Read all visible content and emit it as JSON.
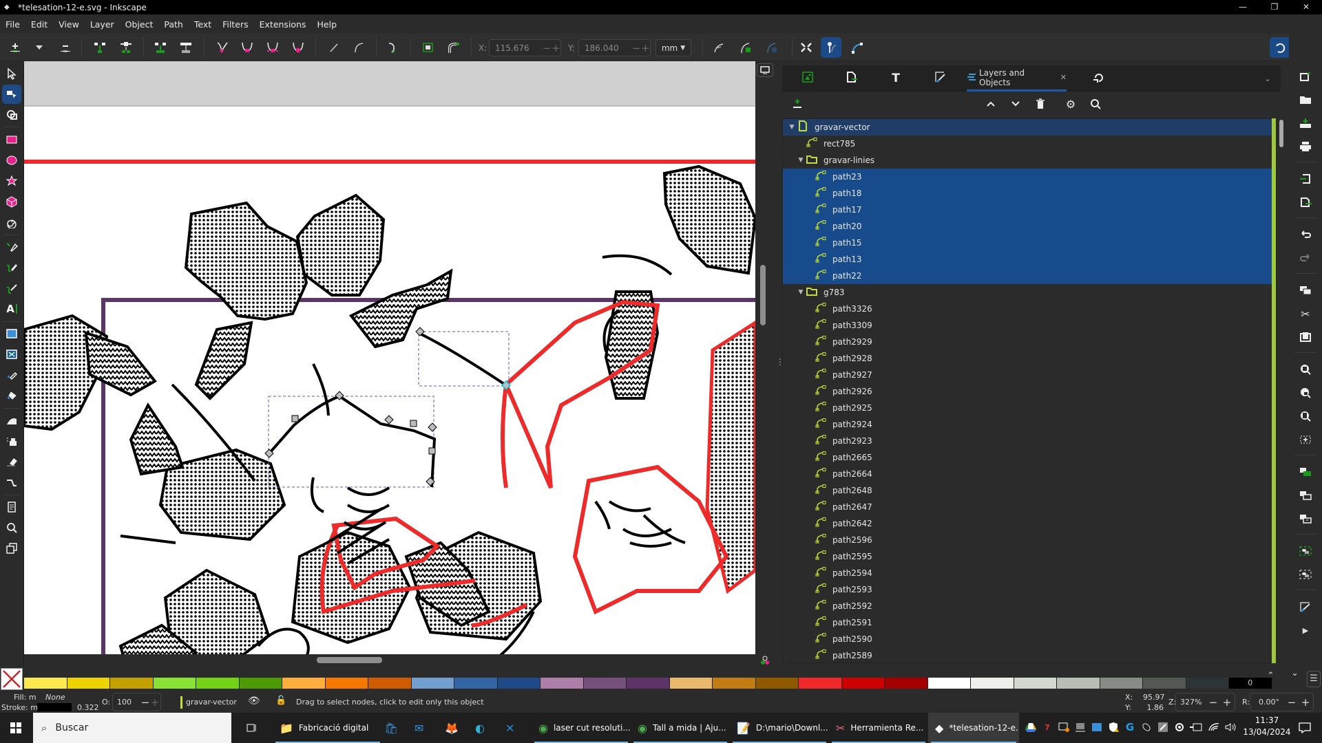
{
  "window": {
    "title": "*telesation-12-e.svg - Inkscape",
    "controls": [
      "minimize",
      "maximize",
      "close"
    ]
  },
  "menu": [
    "File",
    "Edit",
    "View",
    "Layer",
    "Object",
    "Path",
    "Text",
    "Filters",
    "Extensions",
    "Help"
  ],
  "tool_controls": {
    "node_buttons": [
      "insert-node-icon",
      "insert-node-menu-icon",
      "delete-node-icon",
      "join-nodes-icon",
      "break-path-icon",
      "join-segment-icon",
      "delete-segment-icon",
      "cusp-node-icon",
      "smooth-node-icon",
      "symmetric-node-icon",
      "auto-smooth-node-icon",
      "straight-segment-icon",
      "curve-segment-icon",
      "object-to-path-icon",
      "bounding-box-icon",
      "stroke-to-path-icon"
    ],
    "x_label": "X:",
    "x_value": "115.676",
    "y_label": "Y:",
    "y_value": "186.040",
    "unit": "mm",
    "right_buttons": [
      "show-path-effects-icon",
      "show-clipping-icon",
      "show-mask-icon",
      "show-transform-handles-icon",
      "show-handles-icon",
      "show-outline-icon"
    ]
  },
  "toolbox": [
    "selector",
    "node",
    "shape-builder",
    "rectangle",
    "ellipse",
    "star",
    "3d-box",
    "spiral",
    "pen",
    "pencil",
    "calligraphy",
    "text",
    "gradient",
    "mesh",
    "dropper",
    "paint-bucket",
    "tweak",
    "spray",
    "eraser",
    "connector",
    "pages",
    "zoom",
    "measure"
  ],
  "dialog": {
    "tabs": [
      {
        "icon": "document-properties-icon",
        "label": ""
      },
      {
        "icon": "export-icon",
        "label": ""
      },
      {
        "icon": "text-font-icon",
        "label": ""
      },
      {
        "icon": "fill-stroke-icon",
        "label": ""
      },
      {
        "icon": "layers-icon",
        "label": "Layers and Objects",
        "active": true
      },
      {
        "icon": "transform-icon",
        "label": ""
      }
    ],
    "layer_tools": [
      "add-layer",
      "move-up",
      "move-down",
      "delete",
      "settings",
      "search"
    ],
    "tree": [
      {
        "name": "gravar-vector",
        "type": "layer",
        "depth": 0,
        "expanded": true,
        "state": "layer-selected"
      },
      {
        "name": "rect785",
        "type": "path",
        "depth": 1
      },
      {
        "name": "gravar-linies",
        "type": "group",
        "depth": 1,
        "expanded": true
      },
      {
        "name": "path23",
        "type": "path",
        "depth": 2,
        "state": "selected"
      },
      {
        "name": "path18",
        "type": "path",
        "depth": 2,
        "state": "selected"
      },
      {
        "name": "path17",
        "type": "path",
        "depth": 2,
        "state": "selected"
      },
      {
        "name": "path20",
        "type": "path",
        "depth": 2,
        "state": "selected"
      },
      {
        "name": "path15",
        "type": "path",
        "depth": 2,
        "state": "selected"
      },
      {
        "name": "path13",
        "type": "path",
        "depth": 2,
        "state": "selected"
      },
      {
        "name": "path22",
        "type": "path",
        "depth": 2,
        "state": "selected"
      },
      {
        "name": "g783",
        "type": "group",
        "depth": 1,
        "expanded": true
      },
      {
        "name": "path3326",
        "type": "path",
        "depth": 2
      },
      {
        "name": "path3309",
        "type": "path",
        "depth": 2
      },
      {
        "name": "path2929",
        "type": "path",
        "depth": 2
      },
      {
        "name": "path2928",
        "type": "path",
        "depth": 2
      },
      {
        "name": "path2927",
        "type": "path",
        "depth": 2
      },
      {
        "name": "path2926",
        "type": "path",
        "depth": 2
      },
      {
        "name": "path2925",
        "type": "path",
        "depth": 2
      },
      {
        "name": "path2924",
        "type": "path",
        "depth": 2
      },
      {
        "name": "path2923",
        "type": "path",
        "depth": 2
      },
      {
        "name": "path2665",
        "type": "path",
        "depth": 2
      },
      {
        "name": "path2664",
        "type": "path",
        "depth": 2
      },
      {
        "name": "path2648",
        "type": "path",
        "depth": 2
      },
      {
        "name": "path2647",
        "type": "path",
        "depth": 2
      },
      {
        "name": "path2642",
        "type": "path",
        "depth": 2
      },
      {
        "name": "path2596",
        "type": "path",
        "depth": 2
      },
      {
        "name": "path2595",
        "type": "path",
        "depth": 2
      },
      {
        "name": "path2594",
        "type": "path",
        "depth": 2
      },
      {
        "name": "path2593",
        "type": "path",
        "depth": 2
      },
      {
        "name": "path2592",
        "type": "path",
        "depth": 2
      },
      {
        "name": "path2591",
        "type": "path",
        "depth": 2
      },
      {
        "name": "path2590",
        "type": "path",
        "depth": 2
      },
      {
        "name": "path2589",
        "type": "path",
        "depth": 2
      }
    ]
  },
  "commands": [
    "new-document",
    "open",
    "save",
    "print",
    "import",
    "export",
    "undo",
    "redo",
    "copy",
    "cut",
    "paste",
    "zoom-selection",
    "zoom-drawing",
    "zoom-page",
    "zoom-center-page",
    "duplicate",
    "clone",
    "unlink-clone",
    "group",
    "ungroup",
    "fill-stroke",
    "more"
  ],
  "palette": {
    "colors": [
      "#fce94f",
      "#edd400",
      "#c4a000",
      "#8ae234",
      "#73d216",
      "#4e9a06",
      "#fcaf3e",
      "#f57900",
      "#ce5c00",
      "#729fcf",
      "#3465a4",
      "#204a87",
      "#ad7fa8",
      "#75507b",
      "#5c3566",
      "#e9b96e",
      "#c17d11",
      "#8f5902",
      "#ef2929",
      "#cc0000",
      "#a40000",
      "#ffffff",
      "#eeeeec",
      "#d3d7cf",
      "#babdb6",
      "#888a85",
      "#555753",
      "#2e3436",
      "#000000"
    ],
    "last_swatch_label": "0"
  },
  "status": {
    "fill_label": "Fill:",
    "fill_m": "m",
    "fill_value": "None",
    "stroke_label": "Stroke:",
    "stroke_m": "m",
    "stroke_color": "#000000",
    "stroke_width": "0.322",
    "opacity_label": "O:",
    "opacity_value": "100",
    "layer": "gravar-vector",
    "message": "Drag to select nodes, click to edit only this object",
    "cursor_x_label": "X:",
    "cursor_x": "95.97",
    "cursor_y_label": "Y:",
    "cursor_y": "1.86",
    "zoom_label": "Z:",
    "zoom": "327%",
    "rotation_label": "R:",
    "rotation": "0.00°"
  },
  "taskbar": {
    "search_placeholder": "Buscar",
    "apps": [
      {
        "label": "Fabricació digital",
        "icon": "folder-icon"
      },
      {
        "label": "",
        "icon": "store-icon"
      },
      {
        "label": "",
        "icon": "mail-icon"
      },
      {
        "label": "",
        "icon": "firefox-icon"
      },
      {
        "label": "",
        "icon": "edge-icon"
      },
      {
        "label": "",
        "icon": "vscode-icon"
      },
      {
        "label": "laser cut resoluti...",
        "icon": "chrome-icon"
      },
      {
        "label": "Tall a mida | Aju...",
        "icon": "chrome-icon"
      },
      {
        "label": "D:\\mario\\Downl...",
        "icon": "notepad-icon"
      },
      {
        "label": "Herramienta Re...",
        "icon": "snipping-icon"
      },
      {
        "label": "*telesation-12-e...",
        "icon": "inkscape-icon",
        "active": true
      }
    ],
    "time": "11:37",
    "date": "13/04/2024"
  }
}
